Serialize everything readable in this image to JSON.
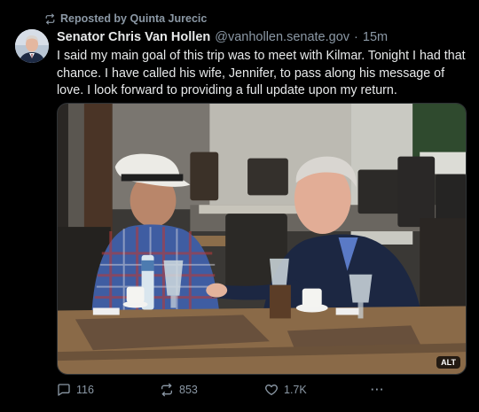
{
  "repost": {
    "icon": "repost-icon",
    "text": "Reposted by Quinta Jurecic"
  },
  "post": {
    "author_name": "Senator Chris Van Hollen",
    "handle": "@vanhollen.senate.gov",
    "separator": "·",
    "time": "15m",
    "text": "I said my main goal of this trip was to meet with Kilmar. Tonight I had that chance. I have called his wife, Jennifer, to pass along his message of love. I look forward to providing a full update upon my return.",
    "media_alt_badge": "ALT"
  },
  "actions": {
    "reply_count": "116",
    "repost_count": "853",
    "like_count": "1.7K",
    "more_label": "···"
  },
  "colors": {
    "background": "#000000",
    "text": "#e7e9ea",
    "muted": "#8b98a5"
  }
}
